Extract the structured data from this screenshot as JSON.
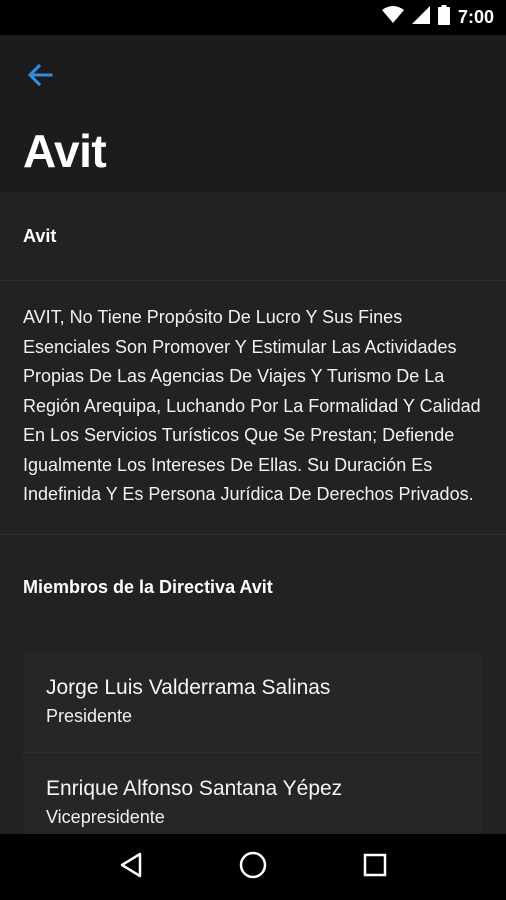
{
  "status_bar": {
    "time": "7:00",
    "icons": [
      "wifi-icon",
      "signal-icon",
      "battery-icon"
    ]
  },
  "app_bar": {
    "back_icon": "arrow-back-icon",
    "title": "Avit",
    "accent_color": "#2f8fe0"
  },
  "section": {
    "header": "Avit",
    "description": "AVIT, No Tiene Propósito De Lucro Y Sus Fines Esenciales Son Promover Y Estimular Las Actividades Propias De Las Agencias De Viajes Y Turismo De La Región Arequipa, Luchando Por La Formalidad Y Calidad En Los Servicios Turísticos Que Se Prestan; Defiende Igualmente Los Intereses De Ellas. Su Duración Es Indefinida Y Es Persona Jurídica De Derechos Privados."
  },
  "members": {
    "header": "Miembros de la Directiva Avit",
    "items": [
      {
        "name": "Jorge Luis Valderrama Salinas",
        "role": "Presidente"
      },
      {
        "name": "Enrique Alfonso Santana Yépez",
        "role": "Vicepresidente"
      }
    ]
  },
  "nav_bar": {
    "icons": [
      "back-triangle-icon",
      "home-circle-icon",
      "recents-square-icon"
    ]
  }
}
